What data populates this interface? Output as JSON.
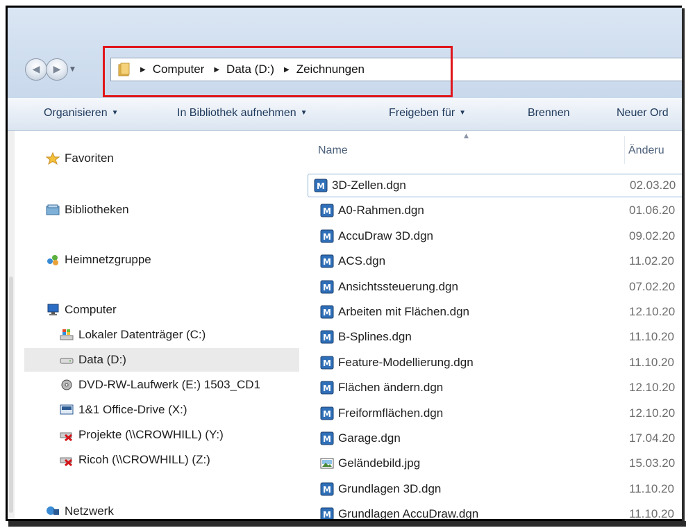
{
  "address_bar": {
    "crumbs": [
      "Computer",
      "Data (D:)",
      "Zeichnungen"
    ]
  },
  "toolbar": {
    "organize": "Organisieren",
    "include_library": "In Bibliothek aufnehmen",
    "share": "Freigeben für",
    "burn": "Brennen",
    "new_folder": "Neuer Ord"
  },
  "nav": {
    "favorites": "Favoriten",
    "libraries": "Bibliotheken",
    "homegroup": "Heimnetzgruppe",
    "computer": "Computer",
    "drives": [
      "Lokaler Datenträger (C:)",
      "Data (D:)",
      "DVD-RW-Laufwerk (E:) 1503_CD1",
      "1&1 Office-Drive (X:)",
      "Projekte (\\\\CROWHILL) (Y:)",
      "Ricoh (\\\\CROWHILL) (Z:)"
    ],
    "network": "Netzwerk"
  },
  "columns": {
    "name": "Name",
    "date": "Änderu"
  },
  "files": [
    {
      "name": "3D-Zellen.dgn",
      "date": "02.03.20"
    },
    {
      "name": "A0-Rahmen.dgn",
      "date": "01.06.20"
    },
    {
      "name": "AccuDraw 3D.dgn",
      "date": "09.02.20"
    },
    {
      "name": "ACS.dgn",
      "date": "11.02.20"
    },
    {
      "name": "Ansichtssteuerung.dgn",
      "date": "07.02.20"
    },
    {
      "name": "Arbeiten mit Flächen.dgn",
      "date": "12.10.20"
    },
    {
      "name": "B-Splines.dgn",
      "date": "11.10.20"
    },
    {
      "name": "Feature-Modellierung.dgn",
      "date": "11.10.20"
    },
    {
      "name": "Flächen ändern.dgn",
      "date": "12.10.20"
    },
    {
      "name": "Freiformflächen.dgn",
      "date": "12.10.20"
    },
    {
      "name": "Garage.dgn",
      "date": "17.04.20"
    },
    {
      "name": "Geländebild.jpg",
      "date": "15.03.20"
    },
    {
      "name": "Grundlagen 3D.dgn",
      "date": "11.10.20"
    },
    {
      "name": "Grundlagen AccuDraw.dgn",
      "date": "11.10.20"
    }
  ],
  "colors": {
    "highlight_box": "#e0161b",
    "toolbar_text": "#1e395b",
    "selected_nav_bg": "#eaeaea"
  }
}
